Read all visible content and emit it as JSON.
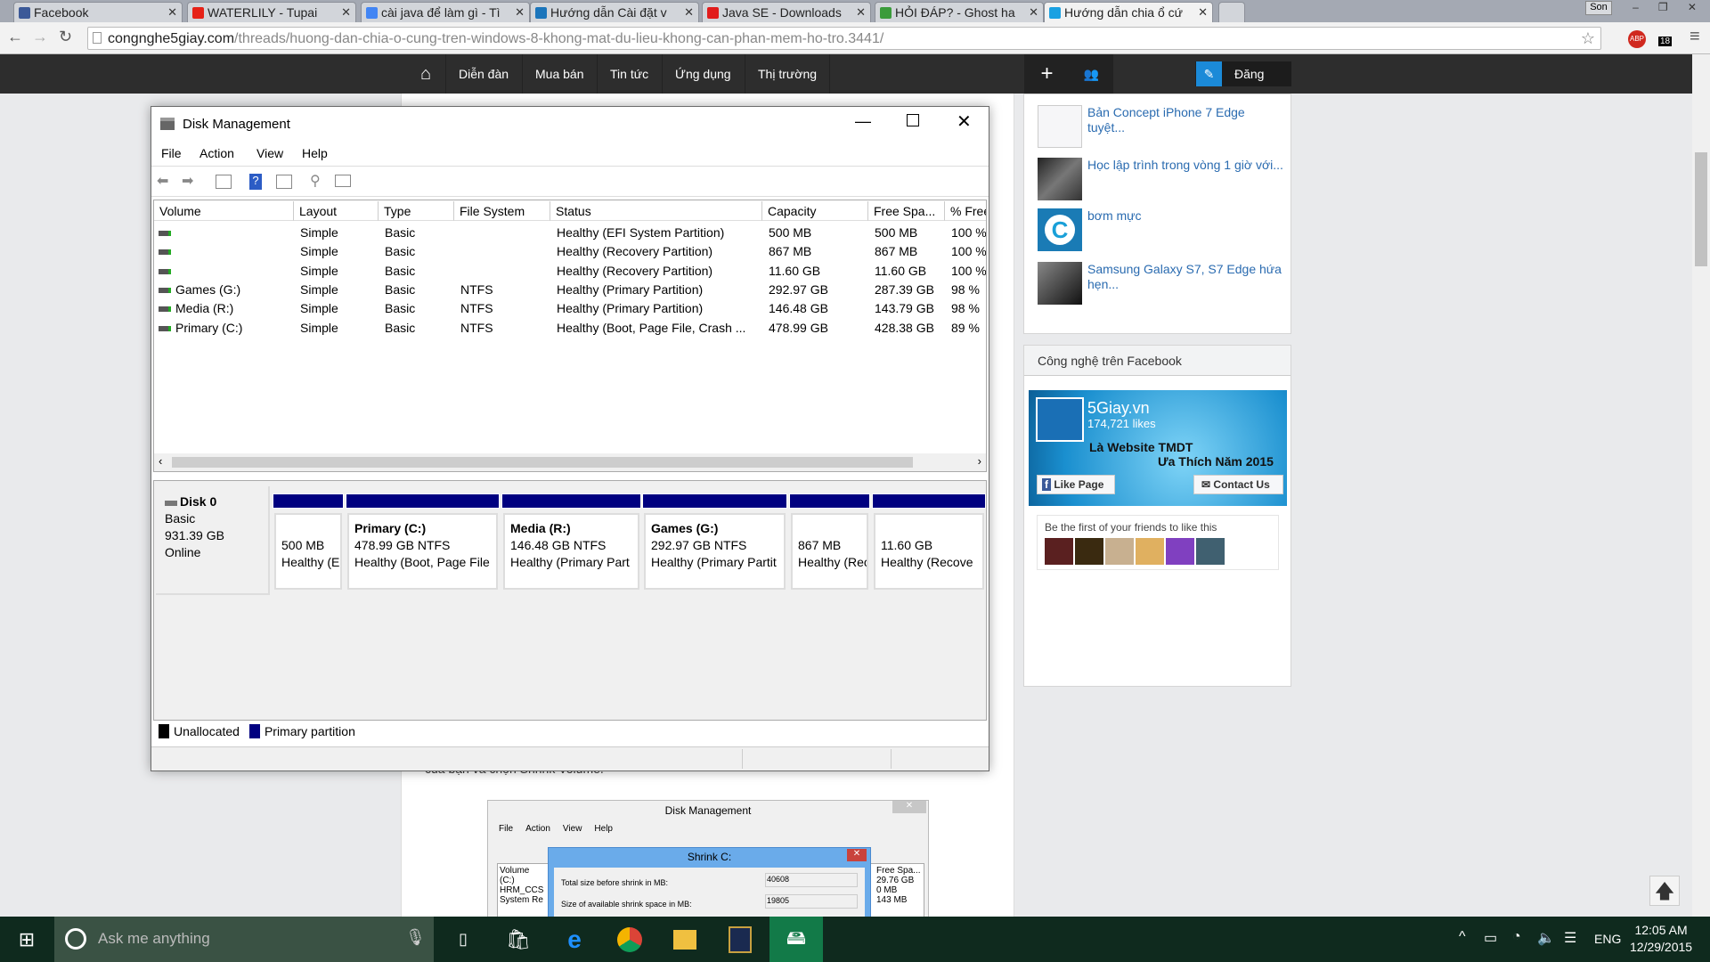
{
  "browser": {
    "tabs": [
      {
        "label": "Facebook",
        "color": "#3b5998",
        "active": false
      },
      {
        "label": "WATERLILY - Tupai",
        "color": "#e62117",
        "active": false
      },
      {
        "label": "cài java để làm gì - Tì",
        "color": "#4285f4",
        "active": false
      },
      {
        "label": "Hướng dẫn Cài đặt v",
        "color": "#1b75bb",
        "active": false
      },
      {
        "label": "Java SE - Downloads",
        "color": "#e11c1c",
        "active": false
      },
      {
        "label": "HỎI ĐÁP? - Ghost ha",
        "color": "#3a9b3a",
        "active": false
      },
      {
        "label": "Hướng dẫn chia ổ cứ",
        "color": "#1ba1e2",
        "active": true
      }
    ],
    "profile": "Son",
    "url_domain": "congnghe5giay.com",
    "url_path": "/threads/huong-dan-chia-o-cung-tren-windows-8-khong-mat-du-lieu-khong-can-phan-mem-ho-tro.3441/",
    "ext_badge": "18"
  },
  "site_nav": {
    "items": [
      "Diễn đàn",
      "Mua bán",
      "Tin tức",
      "Ứng dụng",
      "Thị trường"
    ],
    "post_label": "Đăng tin"
  },
  "sidebar": {
    "items": [
      {
        "title": "Bản Concept iPhone 7 Edge tuyệt..."
      },
      {
        "title": "Học lập trình trong vòng 1 giờ với..."
      },
      {
        "title": "bơm mực"
      },
      {
        "title": "Samsung Galaxy S7, S7 Edge hứa hẹn..."
      }
    ],
    "facebook": {
      "heading": "Công nghệ trên Facebook",
      "page_name": "5Giay.vn",
      "likes": "174,721 likes",
      "banner_line1": "Là Website TMDT",
      "banner_line2": "Ưa Thích Năm 2015",
      "like_button": "Like Page",
      "contact_button": "Contact Us",
      "friends_text": "Be the first of your friends to like this"
    }
  },
  "article": {
    "text_fragment": "của bạn và chọn Shrink Volume.",
    "embedded": {
      "title": "Disk Management",
      "menu": [
        "File",
        "Action",
        "View",
        "Help"
      ],
      "dialog_title": "Shrink C:",
      "field1_label": "Total size before shrink in MB:",
      "field1_value": "40608",
      "field2_label": "Size of available shrink space in MB:",
      "field2_value": "19805",
      "vols": [
        "(C:)",
        "HRM_CCS",
        "System Re"
      ],
      "free_header": "Free Spa...",
      "free": [
        "29.76 GB",
        "0 MB",
        "143 MB"
      ]
    }
  },
  "disk_mgmt": {
    "title": "Disk Management",
    "menu": [
      "File",
      "Action",
      "View",
      "Help"
    ],
    "columns": [
      "Volume",
      "Layout",
      "Type",
      "File System",
      "Status",
      "Capacity",
      "Free Spa...",
      "% Free"
    ],
    "rows": [
      [
        "",
        "Simple",
        "Basic",
        "",
        "Healthy (EFI System Partition)",
        "500 MB",
        "500 MB",
        "100 %"
      ],
      [
        "",
        "Simple",
        "Basic",
        "",
        "Healthy (Recovery Partition)",
        "867 MB",
        "867 MB",
        "100 %"
      ],
      [
        "",
        "Simple",
        "Basic",
        "",
        "Healthy (Recovery Partition)",
        "11.60 GB",
        "11.60 GB",
        "100 %"
      ],
      [
        "Games (G:)",
        "Simple",
        "Basic",
        "NTFS",
        "Healthy (Primary Partition)",
        "292.97 GB",
        "287.39 GB",
        "98 %"
      ],
      [
        "Media (R:)",
        "Simple",
        "Basic",
        "NTFS",
        "Healthy (Primary Partition)",
        "146.48 GB",
        "143.79 GB",
        "98 %"
      ],
      [
        "Primary (C:)",
        "Simple",
        "Basic",
        "NTFS",
        "Healthy (Boot, Page File, Crash ...",
        "478.99 GB",
        "428.38 GB",
        "89 %"
      ]
    ],
    "disk": {
      "name": "Disk 0",
      "type": "Basic",
      "size": "931.39 GB",
      "state": "Online"
    },
    "partitions": [
      {
        "name": "",
        "size": "500 MB",
        "status": "Healthy (EFI System Partition)"
      },
      {
        "name": "Primary  (C:)",
        "size": "478.99 GB NTFS",
        "status": "Healthy (Boot, Page File"
      },
      {
        "name": "Media  (R:)",
        "size": "146.48 GB NTFS",
        "status": "Healthy (Primary Part"
      },
      {
        "name": "Games  (G:)",
        "size": "292.97 GB NTFS",
        "status": "Healthy (Primary Partit"
      },
      {
        "name": "",
        "size": "867 MB",
        "status": "Healthy (Recovery"
      },
      {
        "name": "",
        "size": "11.60 GB",
        "status": "Healthy (Recove"
      }
    ],
    "legend": [
      {
        "label": "Unallocated",
        "color": "#000000"
      },
      {
        "label": "Primary partition",
        "color": "#000080"
      }
    ]
  },
  "taskbar": {
    "search_placeholder": "Ask me anything",
    "lang": "ENG",
    "time": "12:05 AM",
    "date": "12/29/2015"
  }
}
